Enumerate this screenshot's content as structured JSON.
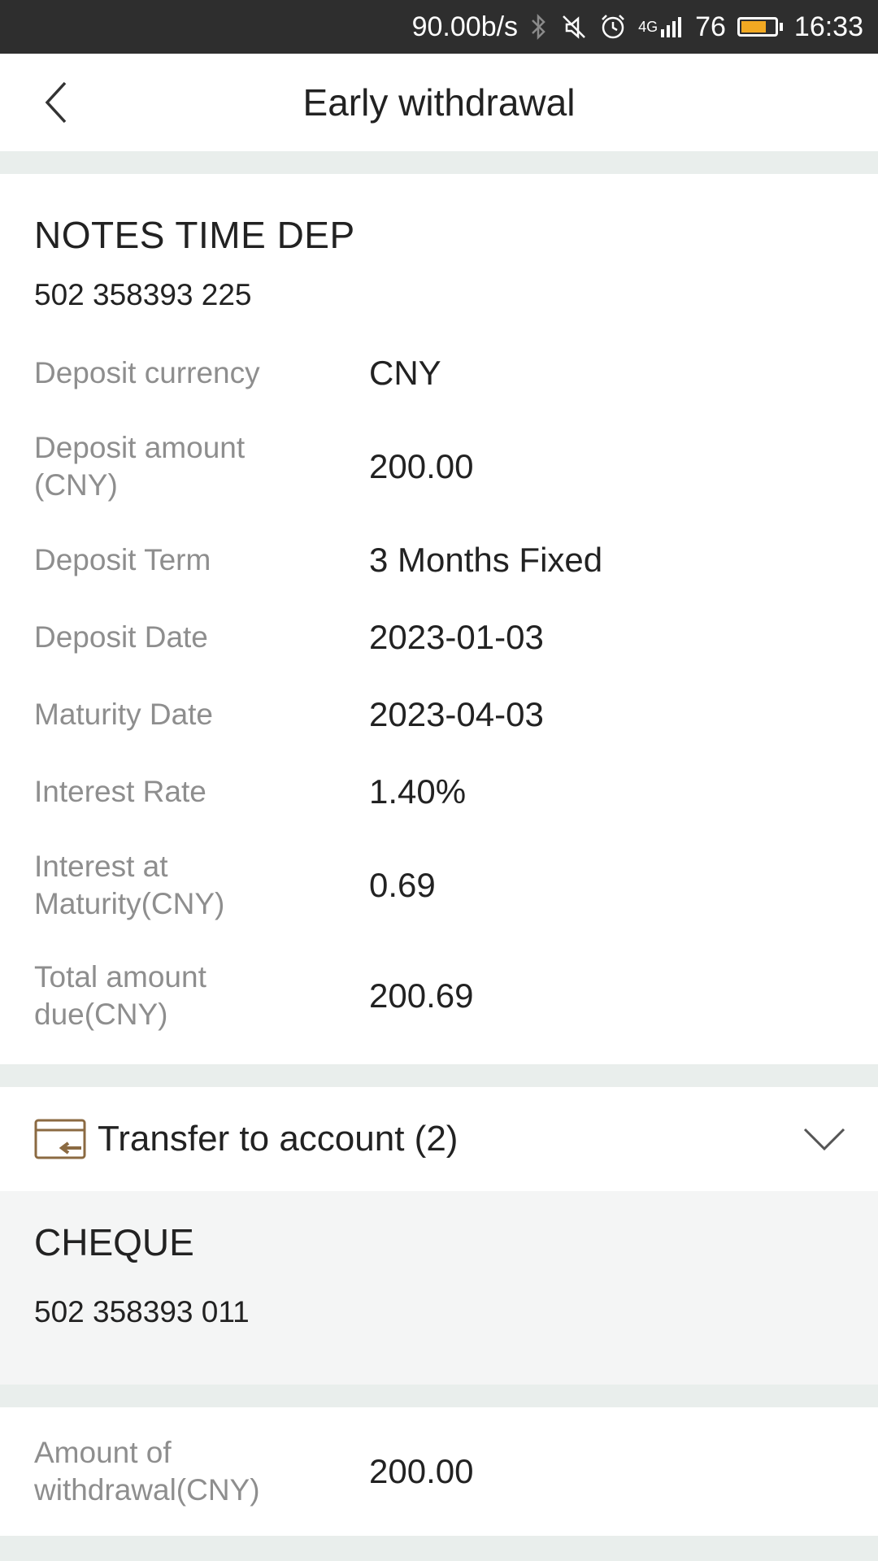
{
  "status_bar": {
    "speed": "90.00b/s",
    "network": "4G",
    "battery": "76",
    "battery_level": 0.76,
    "time": "16:33",
    "icons": [
      "bluetooth-icon",
      "mute-icon",
      "alarm-icon",
      "signal-icon",
      "battery-icon"
    ]
  },
  "nav": {
    "title": "Early withdrawal",
    "back_icon": "back-chevron-icon"
  },
  "deposit": {
    "account_name": "NOTES TIME DEP",
    "account_number": "502 358393 225",
    "details": [
      {
        "label": "Deposit currency",
        "value": "CNY"
      },
      {
        "label": "Deposit amount (CNY)",
        "value": "200.00"
      },
      {
        "label": "Deposit Term",
        "value": "3 Months Fixed"
      },
      {
        "label": "Deposit Date",
        "value": "2023-01-03"
      },
      {
        "label": "Maturity Date",
        "value": "2023-04-03"
      },
      {
        "label": "Interest Rate",
        "value": "1.40%"
      },
      {
        "label": "Interest at Maturity(CNY)",
        "value": "0.69"
      },
      {
        "label": "Total amount due(CNY)",
        "value": "200.69"
      }
    ]
  },
  "transfer": {
    "title": "Transfer to account (2)",
    "icon": "card-transfer-icon",
    "expand_icon": "chevron-down-icon",
    "selected_account": {
      "name": "CHEQUE",
      "number": "502 358393 011"
    }
  },
  "withdrawal": {
    "label": "Amount of withdrawal(CNY)",
    "value": "200.00"
  },
  "colors": {
    "status_bar_bg": "#2e2e2e",
    "accent_brown": "#8b6a42",
    "battery_fill": "#f2a922",
    "label_gray": "#8e8e8e",
    "page_bg": "#e9eeec"
  }
}
